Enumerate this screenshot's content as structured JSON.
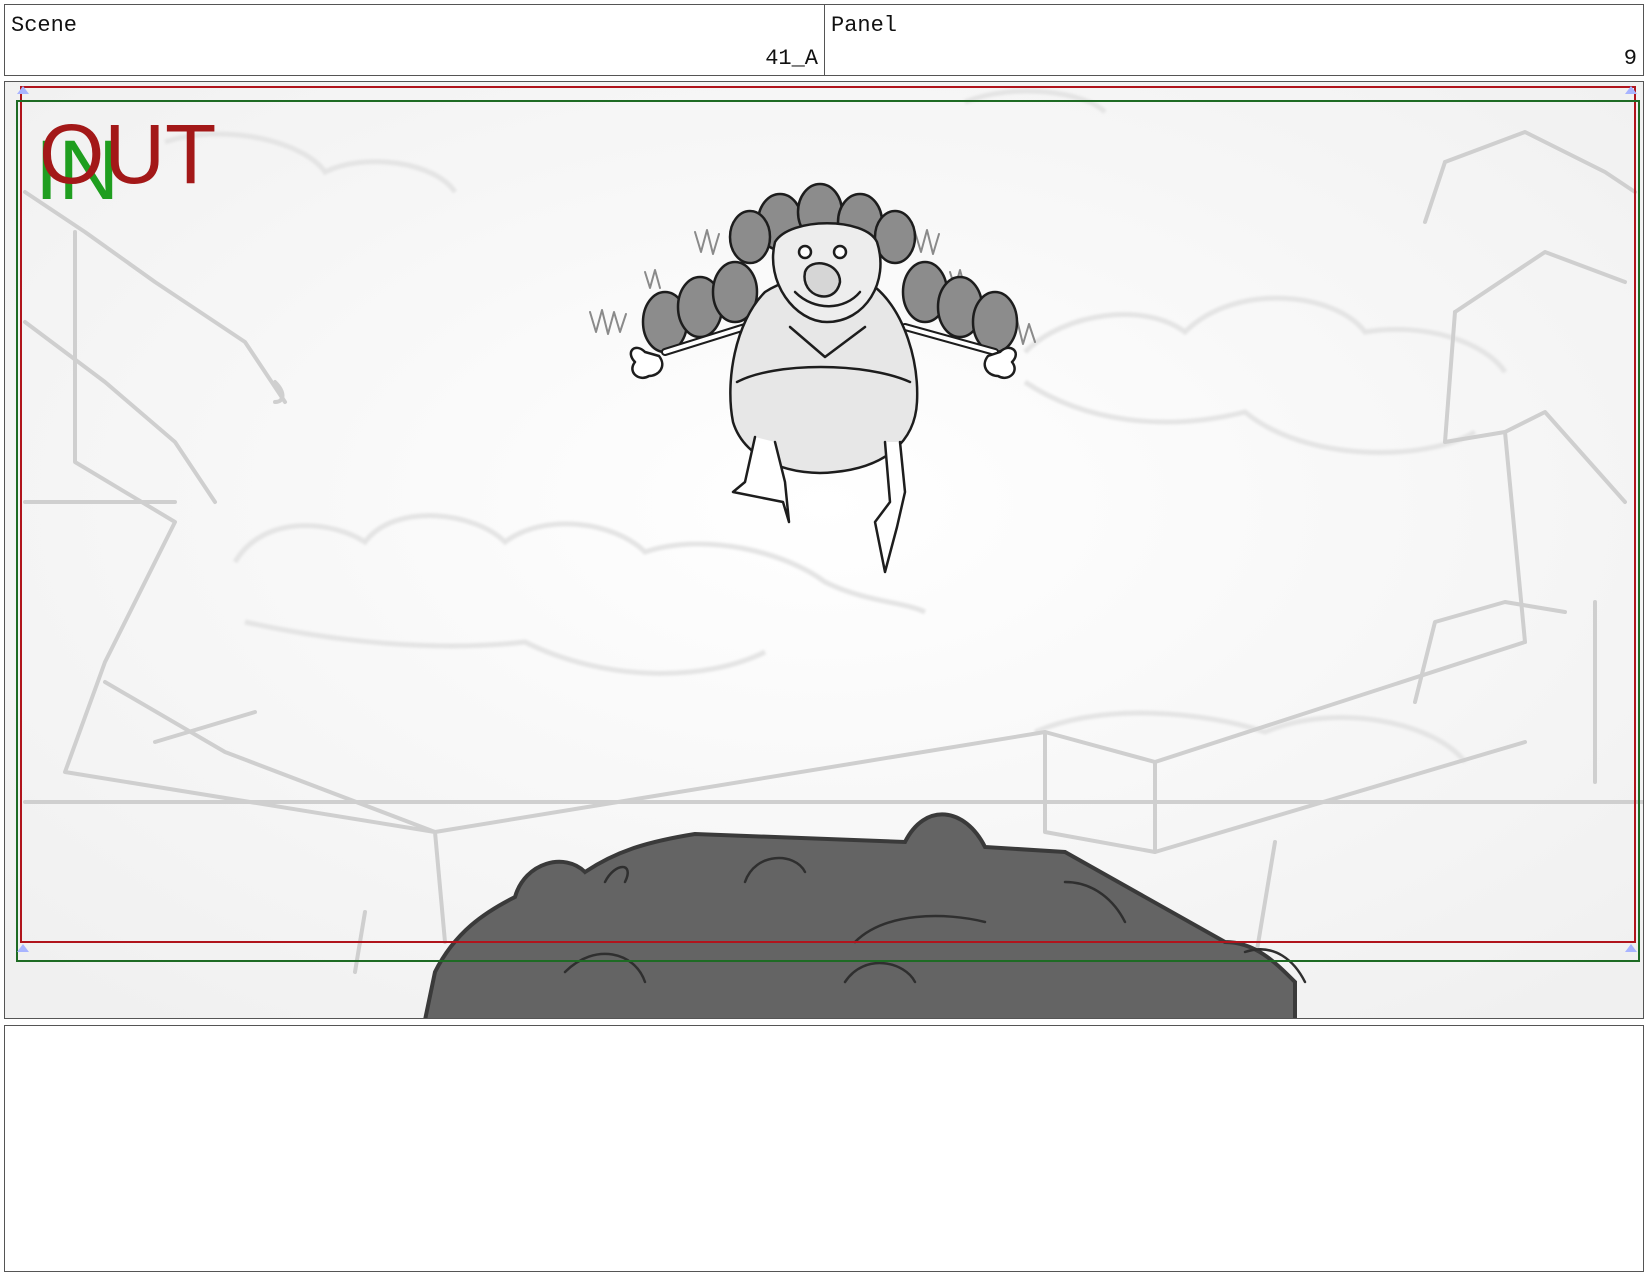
{
  "header": {
    "scene_label": "Scene",
    "scene_value": "41_A",
    "panel_label": "Panel",
    "panel_value": "9"
  },
  "frame": {
    "out_mark": "OUT",
    "in_mark": "IN",
    "out_color": "#a31818",
    "in_color": "#1f9e1f",
    "safe_out_color": "#b0141c",
    "safe_in_color": "#1e6b24"
  },
  "notes": {
    "text": ""
  }
}
